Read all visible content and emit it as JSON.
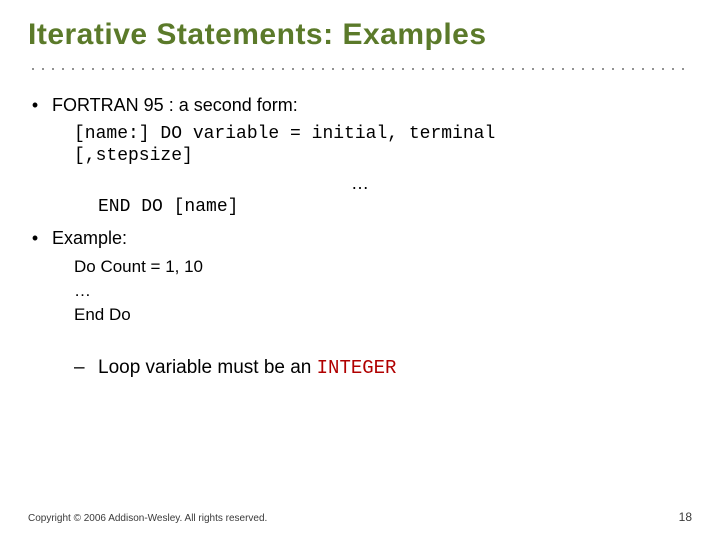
{
  "title": "Iterative Statements: Examples",
  "bullets": {
    "b1_label": "FORTRAN 95 : a second form:",
    "b2_label": "Example:"
  },
  "code_block": {
    "line1": "[name:] DO variable = initial, terminal",
    "line2": "[,stepsize]",
    "ellipsis": "…",
    "line3": "END DO [name]"
  },
  "example_block": {
    "line1": "Do Count  =  1, 10",
    "line2": "  …",
    "line3": "End Do"
  },
  "sub_bullet": {
    "text_before": "Loop variable must be an ",
    "keyword": "INTEGER"
  },
  "footer": {
    "copyright": "Copyright © 2006 Addison-Wesley. All rights reserved.",
    "page": "18"
  },
  "glyphs": {
    "bullet": "•",
    "dash": "–"
  }
}
